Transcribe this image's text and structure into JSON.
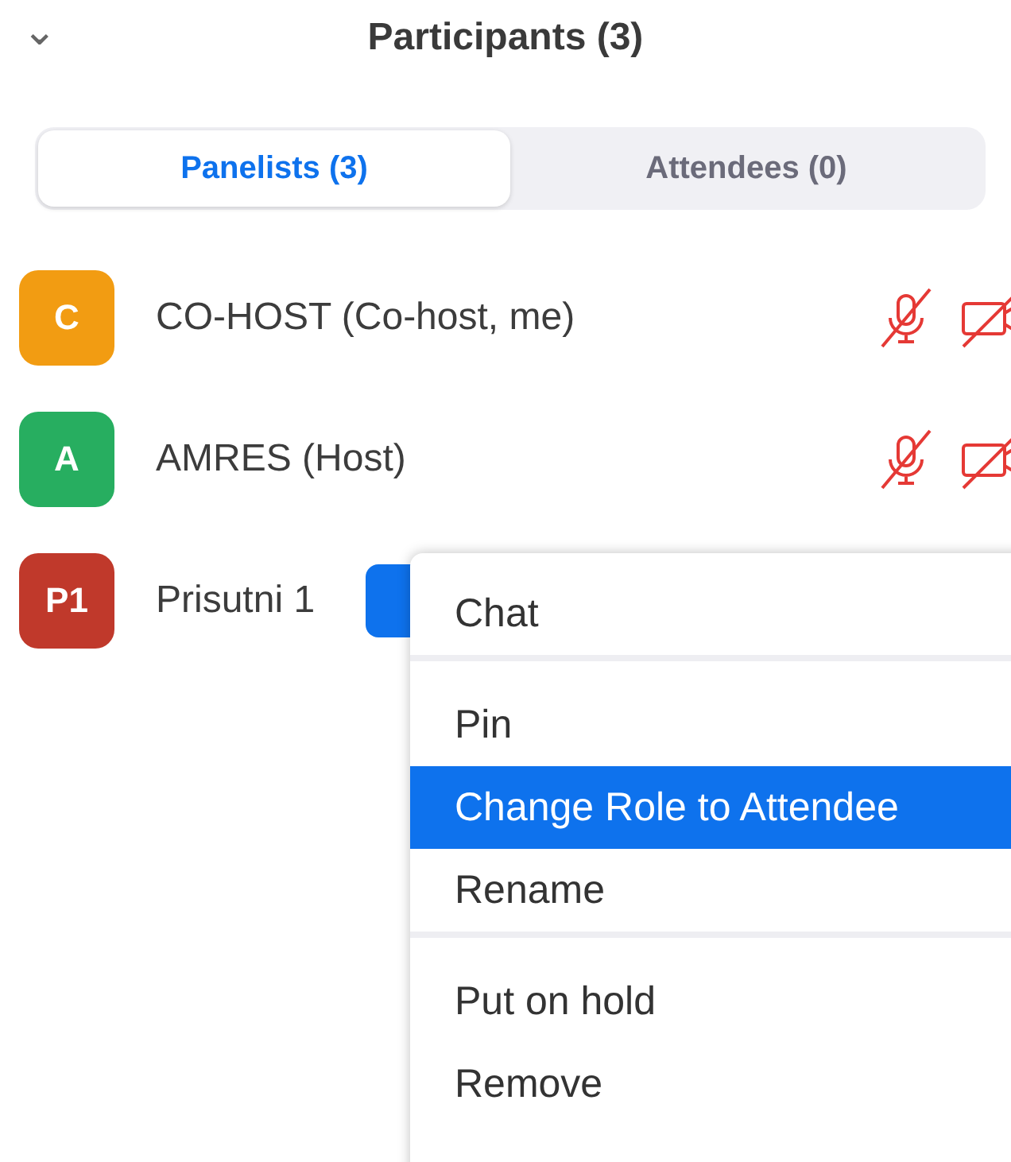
{
  "panel": {
    "title": "Participants (3)",
    "collapse_icon": "⌄"
  },
  "tabs": [
    {
      "label": "Panelists (3)",
      "selected": true
    },
    {
      "label": "Attendees (0)",
      "selected": false
    }
  ],
  "participants": [
    {
      "initials": "C",
      "color": "#f29c12",
      "name": "CO-HOST (Co-host, me)",
      "mic_muted": true,
      "video_off": true
    },
    {
      "initials": "A",
      "color": "#27ae60",
      "name": "AMRES (Host)",
      "mic_muted": true,
      "video_off": true
    },
    {
      "initials": "P1",
      "color": "#c0392b",
      "name": "Prisutni 1",
      "has_button": true
    }
  ],
  "context_menu": {
    "groups": [
      [
        {
          "label": "Chat",
          "selected": false
        }
      ],
      [
        {
          "label": "Pin",
          "selected": false
        },
        {
          "label": "Change Role to Attendee",
          "selected": true
        },
        {
          "label": "Rename",
          "selected": false
        }
      ],
      [
        {
          "label": "Put on hold",
          "selected": false
        },
        {
          "label": "Remove",
          "selected": false
        }
      ]
    ]
  }
}
